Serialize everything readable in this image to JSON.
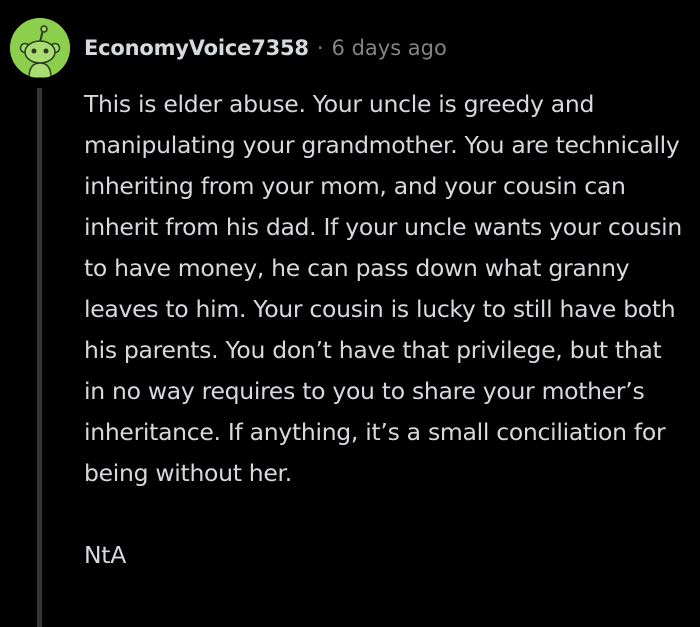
{
  "comment": {
    "username": "EconomyVoice7358",
    "separator": "·",
    "timestamp": "6 days ago",
    "body": [
      "This is elder abuse. Your uncle is greedy and manipulating your grandmother. You are technically inheriting from your mom, and your cousin can inherit from his dad. If your uncle wants your cousin to have money, he can pass down what granny leaves to him. Your cousin is lucky to still have both his parents. You don’t have that privilege, but that in no way requires to you to share your mother’s inheritance. If anything, it’s a small conciliation for being without her.",
      "NtA"
    ]
  },
  "colors": {
    "background": "#000000",
    "text": "#d7dadc",
    "meta": "#818384",
    "thread_line": "#343536",
    "avatar_bg": "#8ccf4d"
  },
  "icons": {
    "avatar": "snoo-avatar-icon"
  }
}
